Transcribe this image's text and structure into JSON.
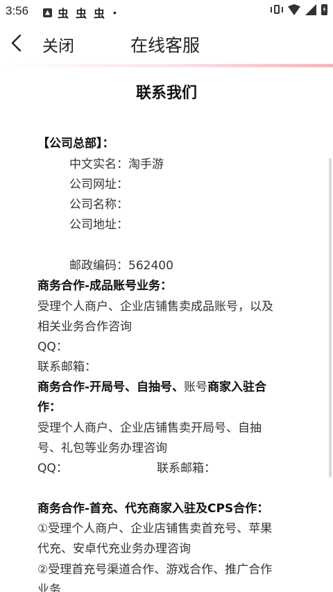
{
  "status_bar": {
    "time": "3:56",
    "icons": [
      "notification-a-icon",
      "bug-icon",
      "bug-icon",
      "bug-icon",
      "dot-icon",
      "vibrate-icon",
      "wifi-icon",
      "signal-icon",
      "battery-charging-icon"
    ],
    "bug_glyph": "虫",
    "dot_glyph": "•"
  },
  "nav": {
    "back_icon": "chevron-left-icon",
    "close_label": "关闭",
    "title": "在线客服"
  },
  "doc": {
    "title": "联系我们",
    "hq_heading": "【公司总部】：",
    "hq_fields": [
      {
        "label": "中文实名：",
        "value": "淘手游"
      },
      {
        "label": "公司网址：",
        "value": ""
      },
      {
        "label": "公司名称：",
        "value": ""
      },
      {
        "label": "公司地址：",
        "value": ""
      },
      {
        "label": "邮政编码：",
        "value": "562400"
      }
    ],
    "section1": {
      "heading": "商务合作-成品账号业务：",
      "body_lines": [
        "受理个人商户、企业店铺售卖成品账号，以及",
        "相关业务合作咨询"
      ],
      "qq_label": "QQ：",
      "email_label": "联系邮箱："
    },
    "section2": {
      "heading_part1": "商务合作-开局号、自抽号、",
      "heading_part2": "账号",
      "heading_part3": "商家入驻合",
      "heading_line2": "作：",
      "body_lines": [
        "受理个人商户、企业店铺售卖开局号、自抽",
        "号、礼包等业务办理咨询"
      ],
      "qq_label": "QQ：",
      "email_label": "联系邮箱："
    },
    "section3": {
      "heading": "商务合作-首充、代充商家入驻及CPS合作：",
      "body_lines": [
        "①受理个人商户、企业店铺售卖首充号、苹果",
        "代充、安卓代充业务办理咨询",
        "②受理首充号渠道合作、游戏合作、推广合作",
        "业务"
      ]
    }
  }
}
